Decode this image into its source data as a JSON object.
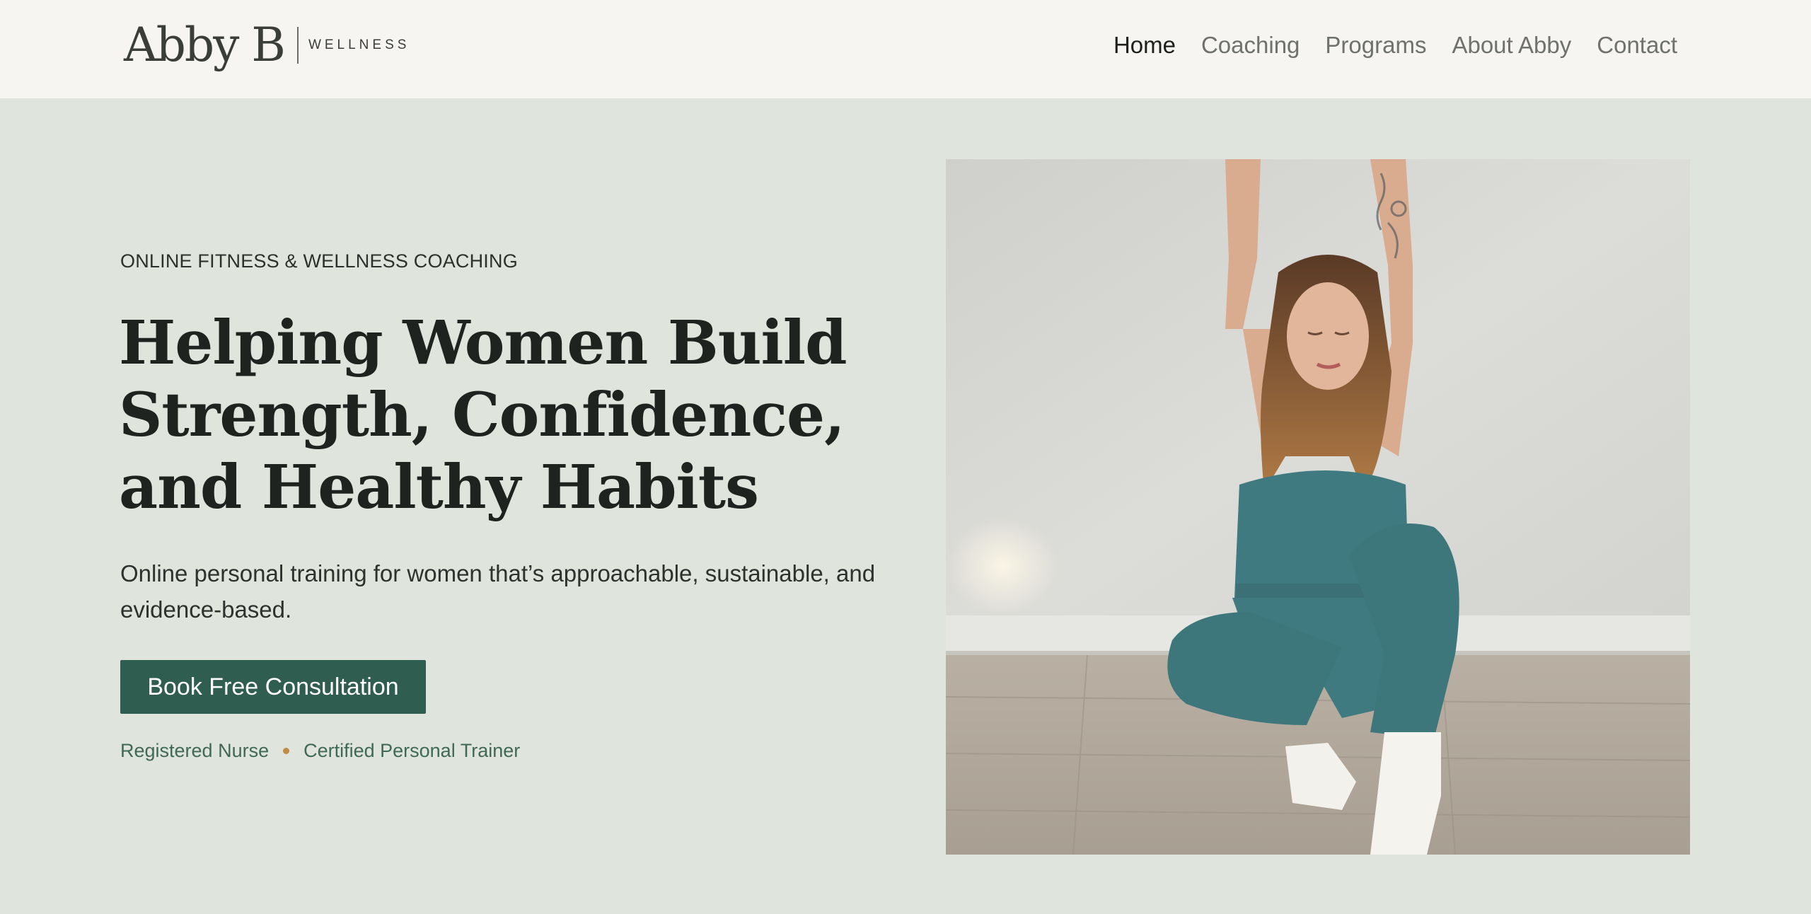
{
  "header": {
    "logo": {
      "mark": "Abby B",
      "sub": "WELLNESS"
    },
    "nav": [
      {
        "label": "Home",
        "active": true
      },
      {
        "label": "Coaching",
        "active": false
      },
      {
        "label": "Programs",
        "active": false
      },
      {
        "label": "About Abby",
        "active": false
      },
      {
        "label": "Contact",
        "active": false
      }
    ]
  },
  "hero": {
    "eyebrow": "ONLINE FITNESS & WELLNESS COACHING",
    "headline": [
      "Helping Women Build",
      "Strength, Confidence,",
      "and Healthy Habits"
    ],
    "lead": "Online personal training for women that’s approachable, sustainable, and evidence-based.",
    "cta_label": "Book Free Consultation",
    "credentials": [
      "Registered Nurse",
      "Certified Personal Trainer"
    ],
    "separator_icon": "dot-icon"
  },
  "image": {
    "subject_icon": "woman-stretching-photo"
  },
  "colors": {
    "page_bg": "#dfe4dd",
    "header_bg": "#f6f5f1",
    "accent": "#2f5d50",
    "credential_text": "#3f6857",
    "dot": "#c38a45",
    "outfit": "#3f7a80"
  }
}
